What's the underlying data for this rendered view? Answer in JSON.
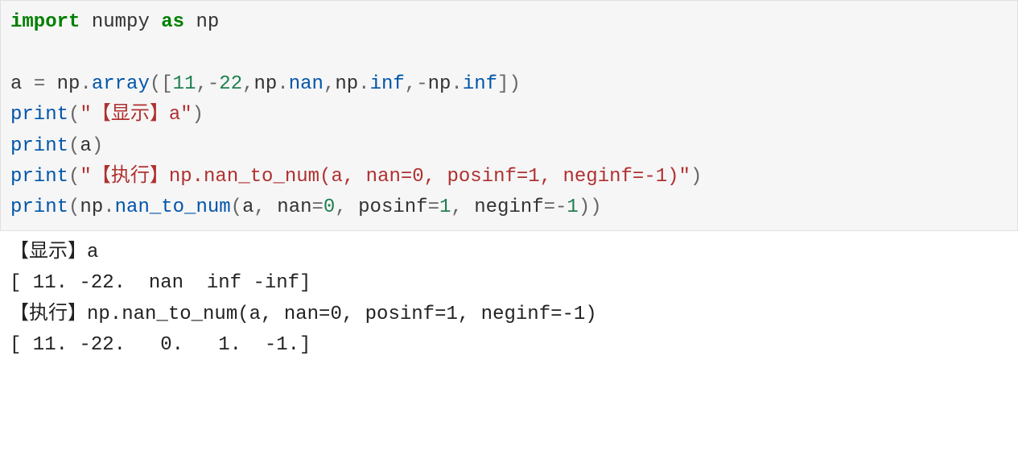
{
  "code": {
    "l1": {
      "kw1": "import",
      "sp1": " ",
      "id1": "numpy",
      "sp2": " ",
      "kw2": "as",
      "sp3": " ",
      "id2": "np"
    },
    "l2": "",
    "l3": {
      "id1": "a",
      "sp1": " ",
      "op1": "=",
      "sp2": " ",
      "id2": "np",
      "op2": ".",
      "fn": "array",
      "op3": "(",
      "op4": "[",
      "n1": "11",
      "op5": ",",
      "m1": "-",
      "n2": "22",
      "op6": ",",
      "id3": "np",
      "op7": ".",
      "id4": "nan",
      "op8": ",",
      "id5": "np",
      "op9": ".",
      "id6": "inf",
      "op10": ",",
      "m2": "-",
      "id7": "np",
      "op11": ".",
      "id8": "inf",
      "op12": "]",
      "op13": ")"
    },
    "l4": {
      "fn": "print",
      "op1": "(",
      "str": "\"【显示】a\"",
      "op2": ")"
    },
    "l5": {
      "fn": "print",
      "op1": "(",
      "id": "a",
      "op2": ")"
    },
    "l6": {
      "fn": "print",
      "op1": "(",
      "str": "\"【执行】np.nan_to_num(a, nan=0, posinf=1, neginf=-1)\"",
      "op2": ")"
    },
    "l7": {
      "fn": "print",
      "op1": "(",
      "id1": "np",
      "op2": ".",
      "fn2": "nan_to_num",
      "op3": "(",
      "id2": "a",
      "op4": ",",
      "sp1": " ",
      "id3": "nan",
      "op5": "=",
      "n1": "0",
      "op6": ",",
      "sp2": " ",
      "id4": "posinf",
      "op7": "=",
      "n2": "1",
      "op8": ",",
      "sp3": " ",
      "id5": "neginf",
      "op9": "=",
      "m1": "-",
      "n3": "1",
      "op10": ")",
      "op11": ")"
    }
  },
  "output": {
    "l1": "【显示】a",
    "l2": "[ 11. -22.  nan  inf -inf]",
    "l3": "【执行】np.nan_to_num(a, nan=0, posinf=1, neginf=-1)",
    "l4": "[ 11. -22.   0.   1.  -1.]"
  }
}
